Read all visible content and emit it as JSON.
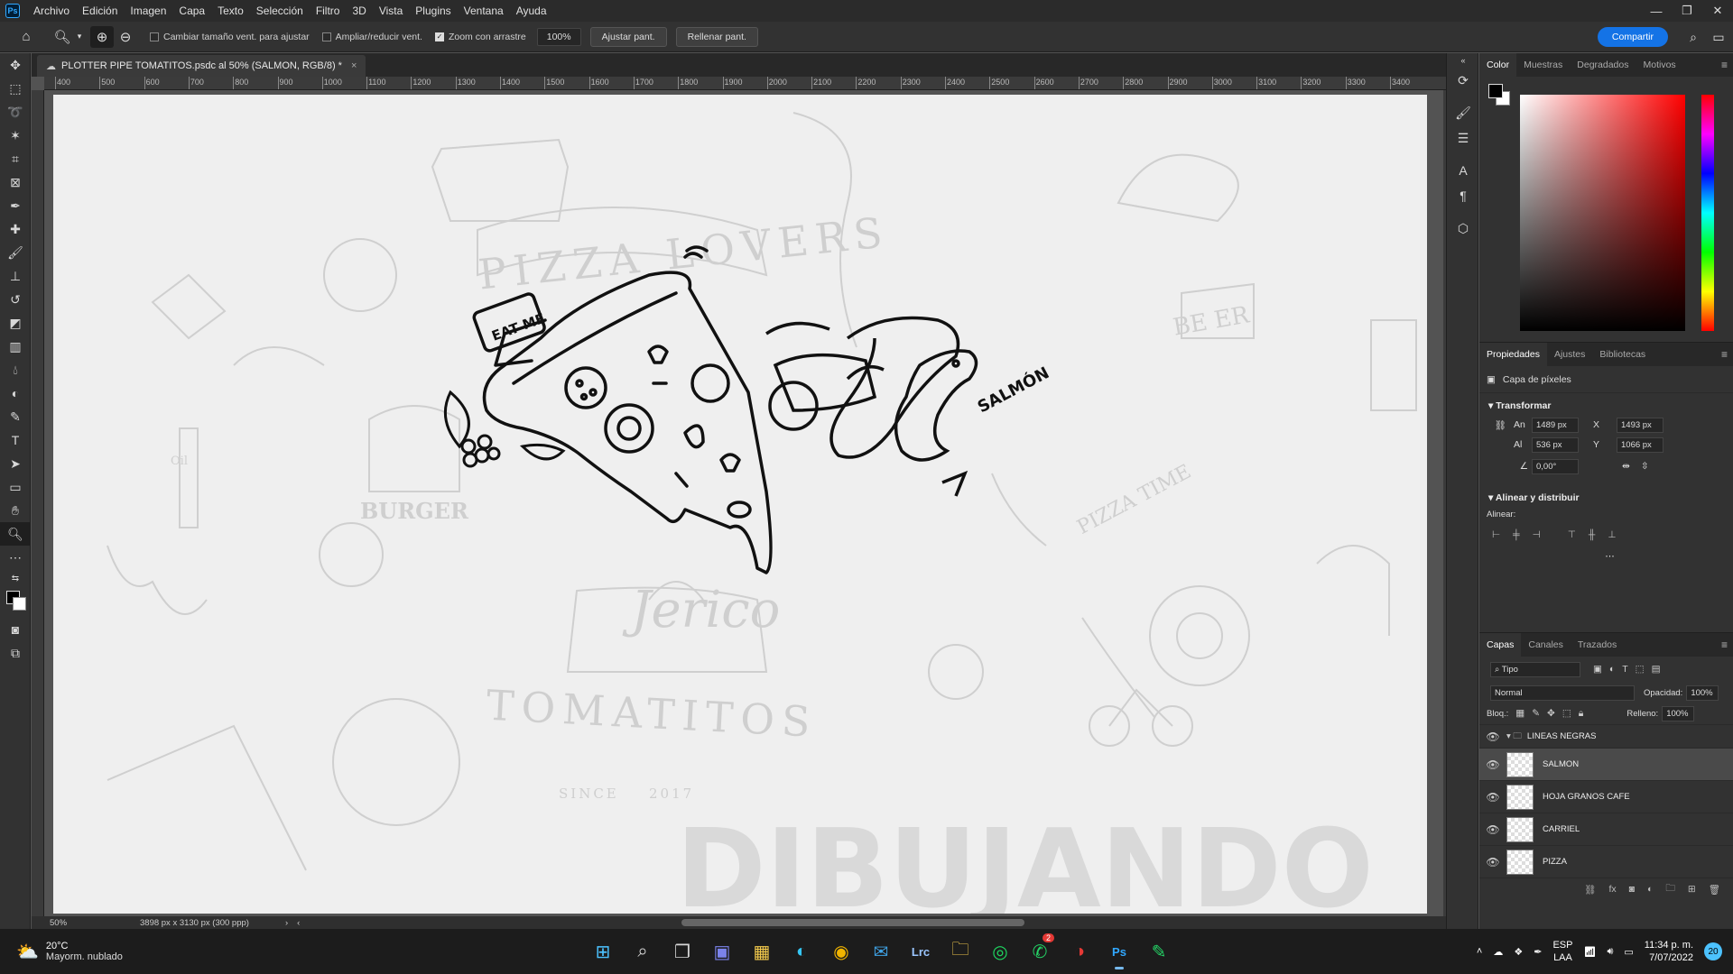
{
  "menubar": {
    "logo": "Ps",
    "items": [
      "Archivo",
      "Edición",
      "Imagen",
      "Capa",
      "Texto",
      "Selección",
      "Filtro",
      "3D",
      "Vista",
      "Plugins",
      "Ventana",
      "Ayuda"
    ]
  },
  "options": {
    "resize_windows": "Cambiar tamaño vent. para ajustar",
    "zoom_all": "Ampliar/reducir vent.",
    "scrubby_zoom": "Zoom con arrastre",
    "zoom_value": "100%",
    "fit_screen": "Ajustar pant.",
    "fill_screen": "Rellenar pant.",
    "share": "Compartir"
  },
  "document": {
    "tab_title": "PLOTTER PIPE TOMATITOS.psdc al 50% (SALMON, RGB/8) *",
    "zoom": "50%",
    "size_info": "3898 px x 3130 px (300 ppp)",
    "ruler_labels": [
      "400",
      "500",
      "600",
      "700",
      "800",
      "900",
      "1000",
      "1100",
      "1200",
      "1300",
      "1400",
      "1500",
      "1600",
      "1700",
      "1800",
      "1900",
      "2000",
      "2100",
      "2200",
      "2300",
      "2400",
      "2500",
      "2600",
      "2700",
      "2800",
      "2900",
      "3000",
      "3100",
      "3200",
      "3300",
      "3400"
    ]
  },
  "artwork": {
    "banner_top": "PIZZA LOVERS",
    "banner_bottom": "TOMATITOS",
    "since": "SINCE",
    "year": "2017",
    "script_name": "Jerico",
    "burger": "BURGER",
    "beer": "BE ER",
    "pizza_time": "PIZZA TIME",
    "eat_me": "EAT ME",
    "salmon": "SALMÓN",
    "oil": "Oil",
    "watermark": "DIBUJANDO"
  },
  "color_panel": {
    "tabs": [
      "Color",
      "Muestras",
      "Degradados",
      "Motivos"
    ],
    "active": "Color"
  },
  "properties": {
    "tabs": [
      "Propiedades",
      "Ajustes",
      "Bibliotecas"
    ],
    "kind": "Capa de píxeles",
    "transform_title": "Transformar",
    "w_label": "An",
    "w": "1489 px",
    "h_label": "Al",
    "h": "536 px",
    "x_label": "X",
    "x": "1493 px",
    "y_label": "Y",
    "y": "1066 px",
    "angle": "0,00°",
    "align_title": "Alinear y distribuir",
    "align_label": "Alinear:"
  },
  "layers_panel": {
    "tabs": [
      "Capas",
      "Canales",
      "Trazados"
    ],
    "filter": "Tipo",
    "blend": "Normal",
    "opacity_label": "Opacidad:",
    "opacity": "100%",
    "lock_label": "Bloq.:",
    "fill_label": "Relleno:",
    "fill": "100%",
    "group": "LINEAS NEGRAS",
    "layers": [
      "SALMON",
      "HOJA GRANOS CAFE",
      "CARRIEL",
      "PIZZA"
    ]
  },
  "taskbar": {
    "weather_temp": "20°C",
    "weather_desc": "Mayorm. nublado",
    "lang": "ESP",
    "lang2": "LAA",
    "time": "11:34 p. m.",
    "date": "7/07/2022",
    "notif": "20",
    "badge": "2"
  }
}
